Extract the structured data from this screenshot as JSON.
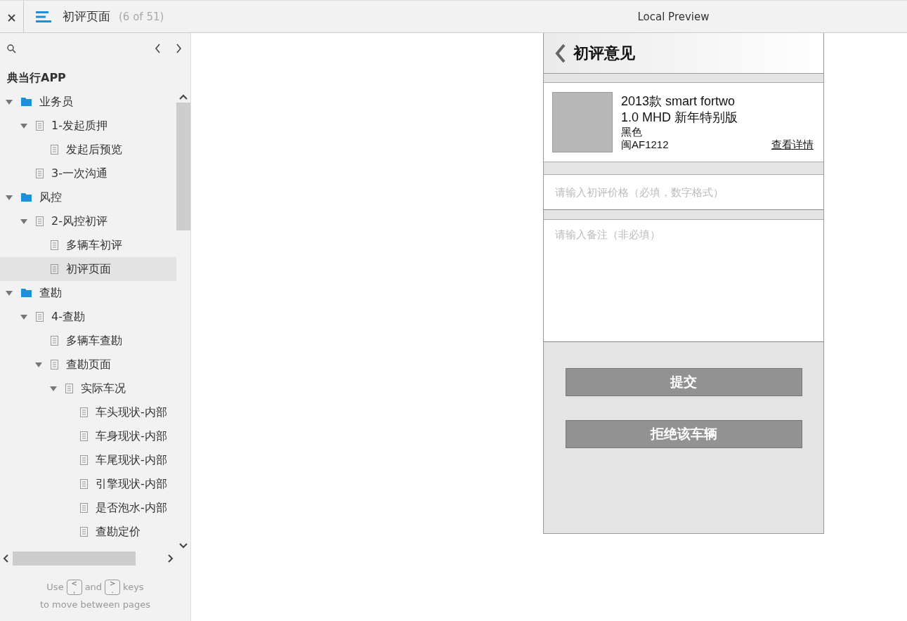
{
  "top_bar": {
    "page_title": "初评页面",
    "page_count": "(6 of 51)",
    "preview_label": "Local Preview"
  },
  "sidebar": {
    "project_title": "典当行APP",
    "tree": [
      {
        "label": "业务员",
        "kind": "folder",
        "expanded": true,
        "selected": false,
        "children": [
          {
            "label": "1-发起质押",
            "kind": "page",
            "expanded": true,
            "selected": false,
            "children": [
              {
                "label": "发起后预览",
                "kind": "page",
                "selected": false
              }
            ]
          },
          {
            "label": "3-一次沟通",
            "kind": "page",
            "selected": false
          }
        ]
      },
      {
        "label": "风控",
        "kind": "folder",
        "expanded": true,
        "selected": false,
        "children": [
          {
            "label": "2-风控初评",
            "kind": "page",
            "expanded": true,
            "selected": false,
            "children": [
              {
                "label": "多辆车初评",
                "kind": "page",
                "selected": false
              },
              {
                "label": "初评页面",
                "kind": "page",
                "selected": true
              }
            ]
          }
        ]
      },
      {
        "label": "查勘",
        "kind": "folder",
        "expanded": true,
        "selected": false,
        "children": [
          {
            "label": "4-查勘",
            "kind": "page",
            "expanded": true,
            "selected": false,
            "children": [
              {
                "label": "多辆车查勘",
                "kind": "page",
                "selected": false
              },
              {
                "label": "查勘页面",
                "kind": "page",
                "expanded": true,
                "selected": false,
                "children": [
                  {
                    "label": "实际车况",
                    "kind": "page",
                    "expanded": true,
                    "selected": false,
                    "children": [
                      {
                        "label": "车头现状-内部",
                        "kind": "page",
                        "selected": false
                      },
                      {
                        "label": "车身现状-内部",
                        "kind": "page",
                        "selected": false
                      },
                      {
                        "label": "车尾现状-内部",
                        "kind": "page",
                        "selected": false
                      },
                      {
                        "label": "引擎现状-内部",
                        "kind": "page",
                        "selected": false
                      },
                      {
                        "label": "是否泡水-内部",
                        "kind": "page",
                        "selected": false
                      },
                      {
                        "label": "查勘定价",
                        "kind": "page",
                        "selected": false
                      }
                    ]
                  }
                ]
              }
            ]
          }
        ]
      }
    ],
    "hint": {
      "before": "Use",
      "key_prev": [
        "<",
        ","
      ],
      "middle": "and",
      "key_next": [
        ">",
        "."
      ],
      "after": "keys",
      "line2": "to move between pages"
    }
  },
  "phone": {
    "title": "初评意见",
    "car": {
      "name_line1": "2013款 smart fortwo",
      "name_line2": "1.0 MHD 新年特别版",
      "paint_color": "黑色",
      "plate": "闽AF1212",
      "details_link": "查看详情"
    },
    "price_field": {
      "placeholder": "请输入初评价格（必填，数字格式）"
    },
    "note_field": {
      "placeholder": "请输入备注（非必填）"
    },
    "buttons": [
      "提交",
      "拒绝该车辆"
    ]
  }
}
